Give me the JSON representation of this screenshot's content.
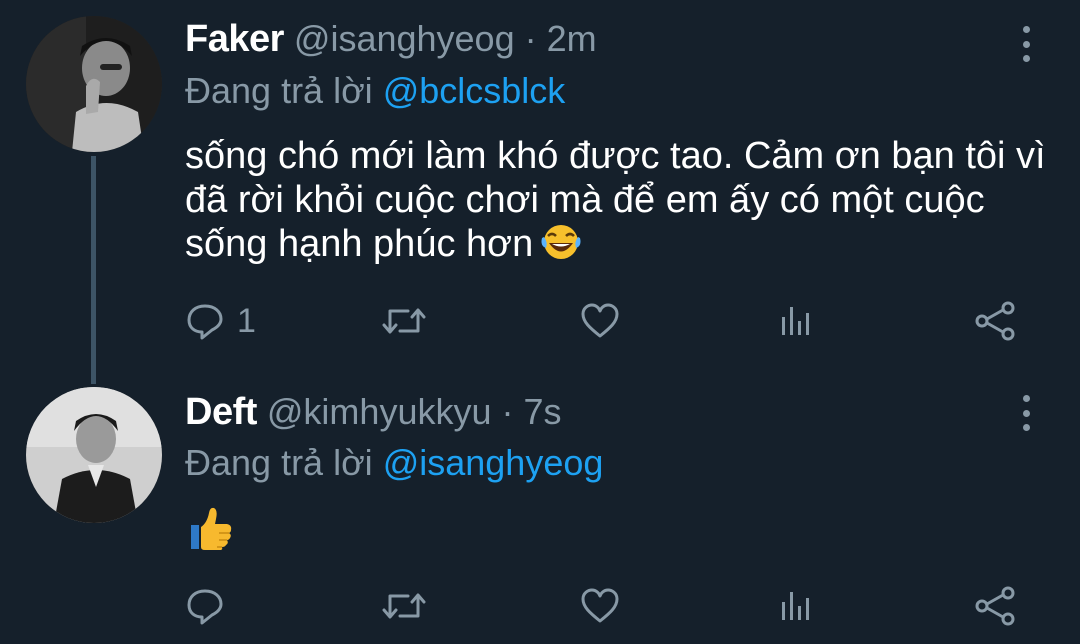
{
  "tweets": [
    {
      "display_name": "Faker",
      "handle": "@isanghyeog",
      "separator": "·",
      "time": "2m",
      "reply_prefix": "Đang trả lời",
      "reply_to": "@bclcsblck",
      "text": "sống chó mới làm khó được tao. Cảm ơn bạn tôi vì đã rời khỏi cuộc chơi mà để em ấy có một cuộc sống hạnh phúc hơn",
      "emoji": "face-with-tears-of-joy",
      "reply_count": "1",
      "icons": [
        "reply-icon",
        "retweet-icon",
        "like-icon",
        "stats-icon",
        "share-icon"
      ]
    },
    {
      "display_name": "Deft",
      "handle": "@kimhyukkyu",
      "separator": "·",
      "time": "7s",
      "reply_prefix": "Đang trả lời",
      "reply_to": "@isanghyeog",
      "text": "",
      "emoji": "thumbs-up",
      "reply_count": "",
      "icons": [
        "reply-icon",
        "retweet-icon",
        "like-icon",
        "stats-icon",
        "share-icon"
      ]
    }
  ],
  "colors": {
    "background": "#15202b",
    "primary_text": "#ffffff",
    "secondary_text": "#8899a6",
    "link": "#1da1f2",
    "thread_line": "#3d5466"
  }
}
